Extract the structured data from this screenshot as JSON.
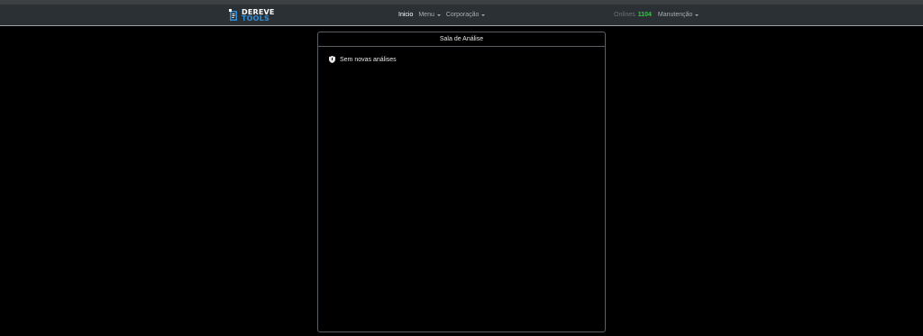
{
  "brand": {
    "line1": "DEREVE",
    "line2": "TOOLS",
    "colors": {
      "primary": "#ffffff",
      "secondary": "#2f8fd8"
    }
  },
  "nav": {
    "items": [
      {
        "label": "Inicio",
        "active": true,
        "dropdown": false
      },
      {
        "label": "Menu",
        "active": false,
        "dropdown": true
      },
      {
        "label": "Corporação",
        "active": false,
        "dropdown": true
      }
    ],
    "online_label": "Onlines",
    "online_count": "1104",
    "online_color": "#2ecc40",
    "maintenance_label": "Manutenção"
  },
  "panel": {
    "title": "Sala de Análise",
    "empty_message": "Sem novas análises",
    "empty_icon": "shield-icon"
  }
}
